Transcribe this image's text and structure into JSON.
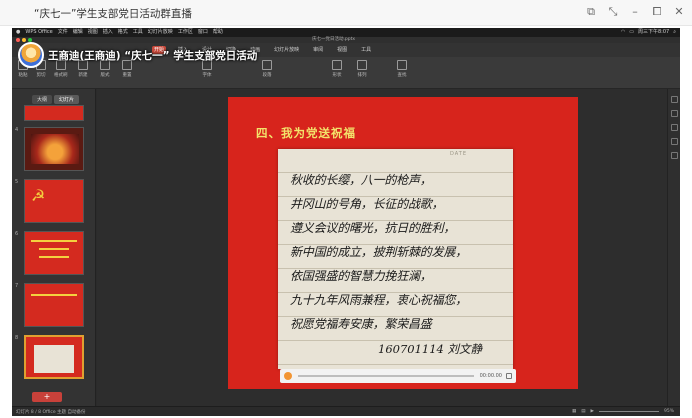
{
  "window": {
    "title": "“庆七一”学生支部党日活动群直播",
    "controls": [
      "⧉",
      "⤡",
      "–",
      "⧠",
      "✕"
    ]
  },
  "presenter": {
    "name": "王商迪(王商迪) “庆七一” 学生支部党日活动"
  },
  "mac_menu": {
    "items": [
      "WPS Office",
      "文件",
      "编辑",
      "视图",
      "插入",
      "格式",
      "工具",
      "幻灯片放映",
      "工作区",
      "窗口",
      "帮助"
    ],
    "status": "周三下午8:07"
  },
  "wps": {
    "file_name": "庆七一党日活动.pptx",
    "tabs": [
      "开始",
      "插入",
      "设计",
      "切换",
      "动画",
      "幻灯片放映",
      "审阅",
      "视图",
      "工具"
    ],
    "active_tab": "开始",
    "tools": [
      "粘贴",
      "剪切",
      "格式刷",
      "新建",
      "版式",
      "重置",
      "字体",
      "段落",
      "形状",
      "排列",
      "查找"
    ]
  },
  "left_panel": {
    "tabs": [
      "大纲",
      "幻灯片"
    ],
    "slide_numbers": [
      "",
      "4",
      "5",
      "6",
      "7",
      "8"
    ],
    "add_label": "+"
  },
  "slide": {
    "heading": "四、我为党送祝福",
    "paper_date": "DATE",
    "lines": [
      "秋收的长缨，八一的枪声，",
      "井冈山的号角，长征的战歌，",
      "遵义会议的曙光，抗日的胜利，",
      "新中国的成立，披荆斩棘的发展，",
      "依国强盛的智慧力挽狂澜，",
      "九十九年风雨兼程，衷心祝福您，",
      "祝愿党福寿安康，繁荣昌盛"
    ],
    "signature": "160701114 刘文静"
  },
  "player": {
    "time": "00:00.00"
  },
  "status_bar": {
    "left": "幻灯片 8 / 8   Office 主题   自动备份",
    "zoom": "95%"
  }
}
